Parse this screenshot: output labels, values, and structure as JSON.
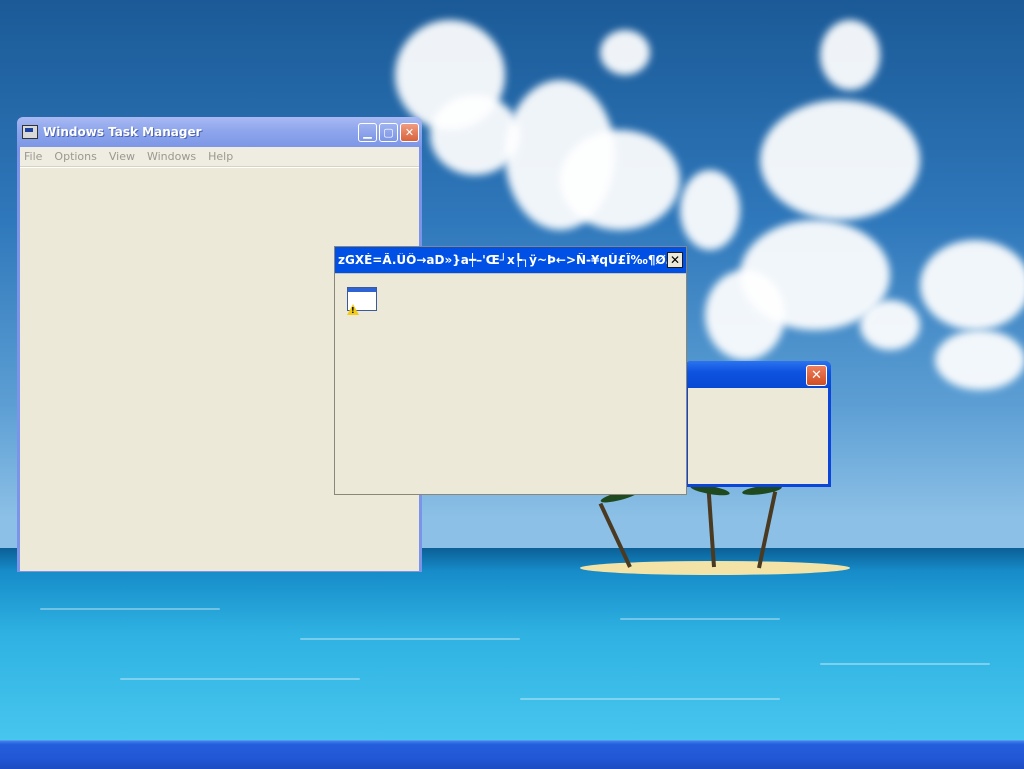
{
  "task_manager": {
    "title": "Windows Task Manager",
    "menu": [
      "File",
      "Options",
      "View",
      "Windows",
      "Help"
    ],
    "minimize_glyph": "▁",
    "maximize_glyph": "▢",
    "close_glyph": "✕"
  },
  "error_dialog": {
    "title": "zGXÉ=Ã.ÜÔ→aD»}a┿–'Œ┘x┡┐ÿ~Þ←>Ñ-¥qÙ£Ï‰¶Ø…",
    "close_glyph": "✕",
    "icon": "warning-window-icon"
  },
  "back_dialog": {
    "close_glyph": "✕"
  },
  "colors": {
    "taskbar": "#245edc",
    "active_title": "#0050e6",
    "inactive_title": "#8ea6ec",
    "window_face": "#ece9d8",
    "close_red": "#d9623c"
  }
}
